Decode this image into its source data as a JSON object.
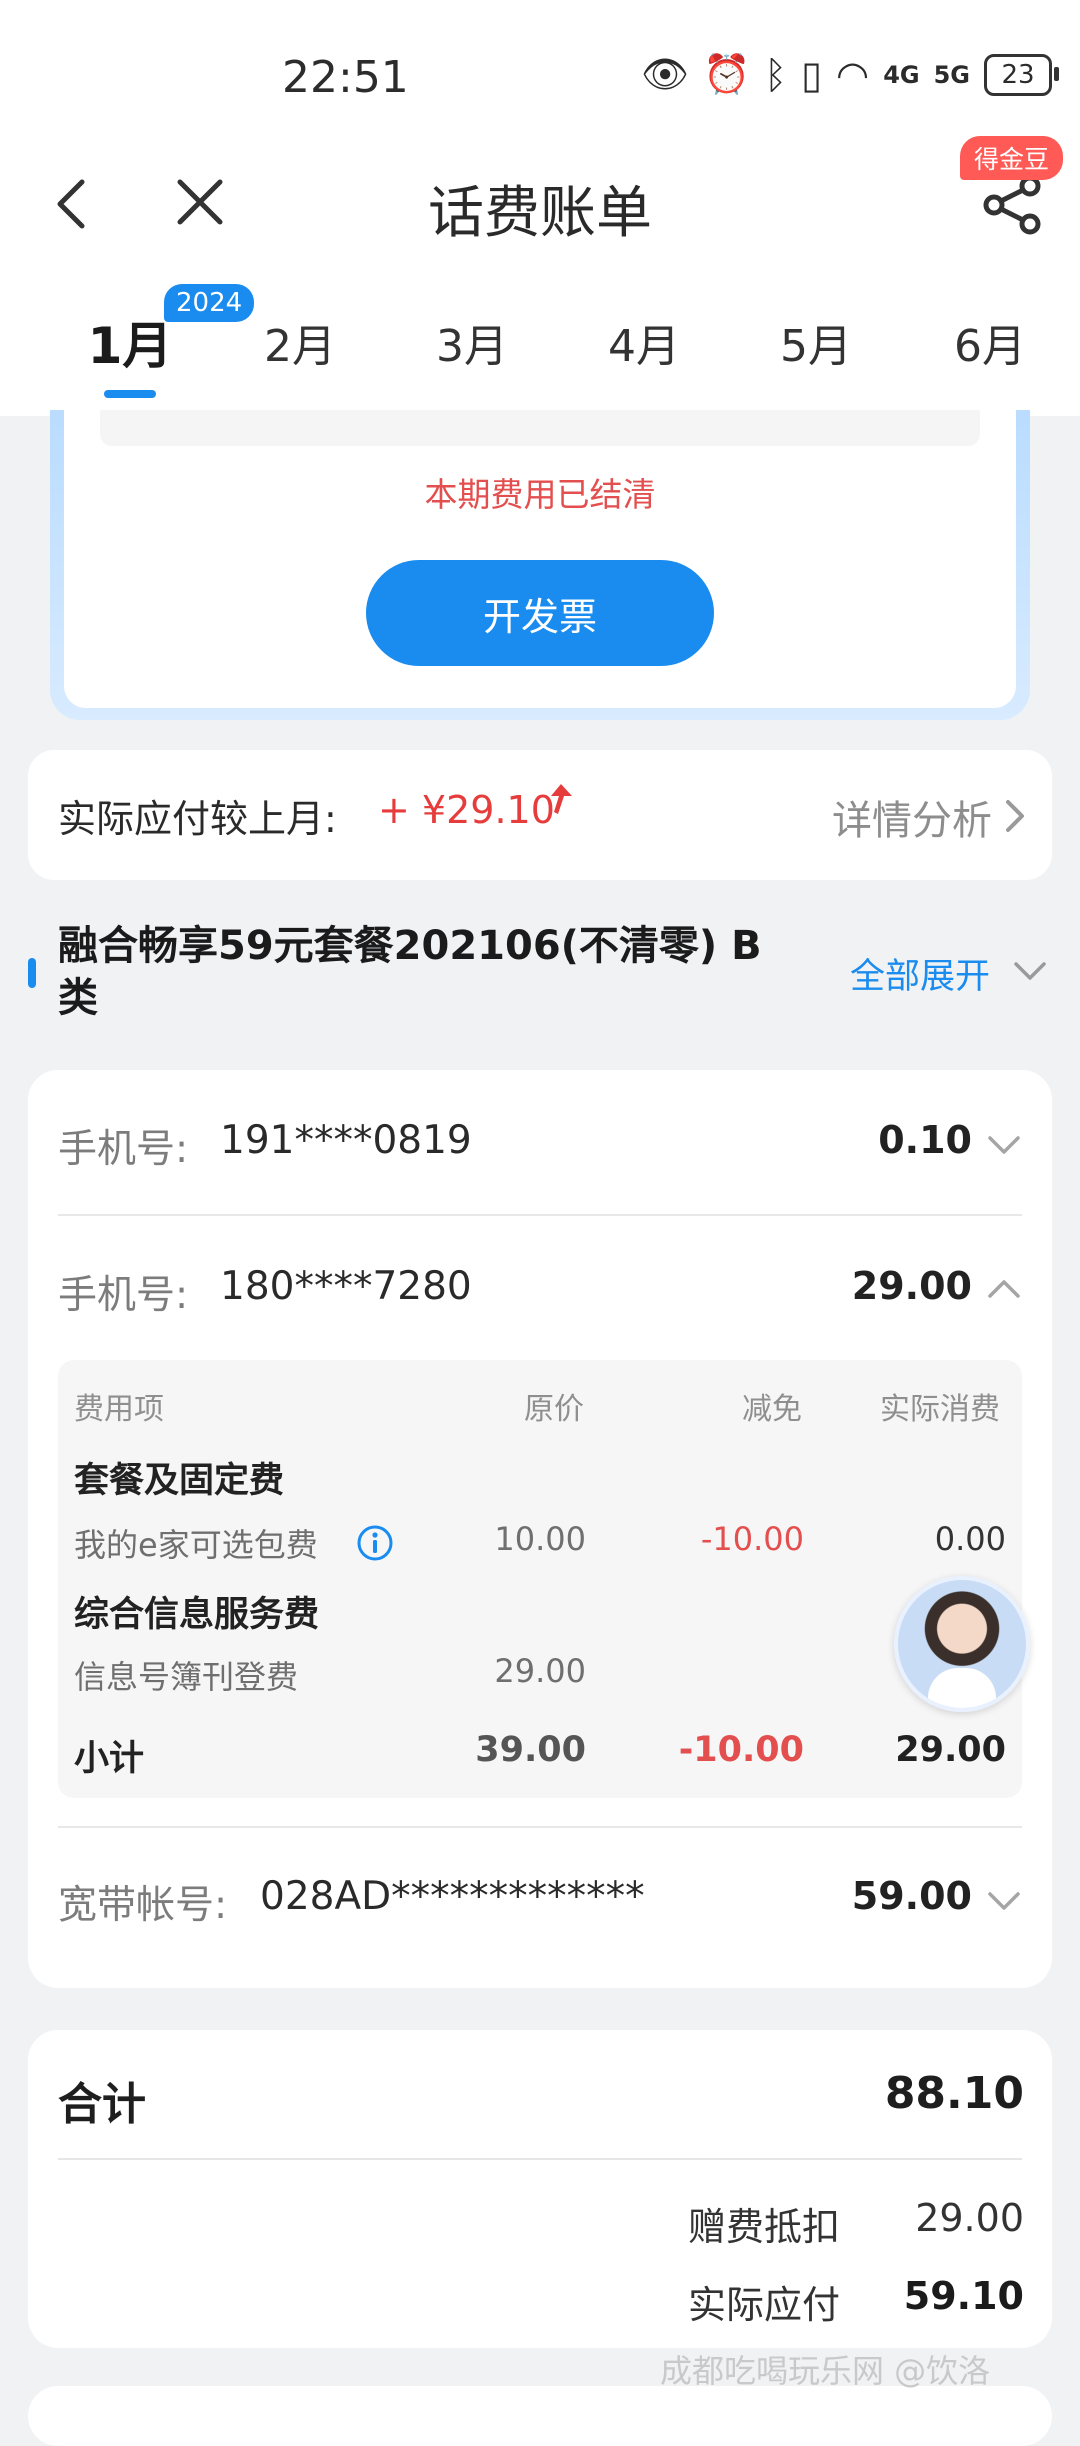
{
  "status_bar": {
    "time": "22:51",
    "network_4g": "4G",
    "network_5g": "5G",
    "battery": "23"
  },
  "header": {
    "title": "话费账单",
    "bonus_badge": "得金豆"
  },
  "tabs": {
    "year_badge": "2024",
    "months": [
      "1月",
      "2月",
      "3月",
      "4月",
      "5月",
      "6月"
    ],
    "active_index": 0
  },
  "invoice": {
    "status_text": "本期费用已结清",
    "button_label": "开发票"
  },
  "compare": {
    "label": "实际应付较上月:",
    "value": "+ ¥29.10",
    "detail_link": "详情分析"
  },
  "plan": {
    "title": "融合畅享59元套餐202106(不清零) B类",
    "expand_all": "全部展开"
  },
  "lines": [
    {
      "label": "手机号:",
      "number": "191****0819",
      "amount": "0.10",
      "expanded": false
    },
    {
      "label": "手机号:",
      "number": "180****7280",
      "amount": "29.00",
      "expanded": true
    },
    {
      "label": "宽带帐号:",
      "number": "028AD*************",
      "amount": "59.00",
      "expanded": false
    }
  ],
  "detail": {
    "headers": [
      "费用项",
      "原价",
      "减免",
      "实际消费"
    ],
    "group1": "套餐及固定费",
    "item1": {
      "name": "我的e家可选包费",
      "original": "10.00",
      "discount": "-10.00",
      "actual": "0.00"
    },
    "group2": "综合信息服务费",
    "item2": {
      "name": "信息号簿刊登费",
      "original": "29.00"
    },
    "subtotal": {
      "label": "小计",
      "original": "39.00",
      "discount": "-10.00",
      "actual": "29.00"
    }
  },
  "summary": {
    "total_label": "合计",
    "total_value": "88.10",
    "gift_label": "赠费抵扣",
    "gift_value": "29.00",
    "payable_label": "实际应付",
    "payable_value": "59.10"
  },
  "watermark": "成都吃喝玩乐网 @饮洛",
  "colors": {
    "accent": "#1a8cf0",
    "red": "#e34f4f",
    "badge": "#ff5a55"
  }
}
